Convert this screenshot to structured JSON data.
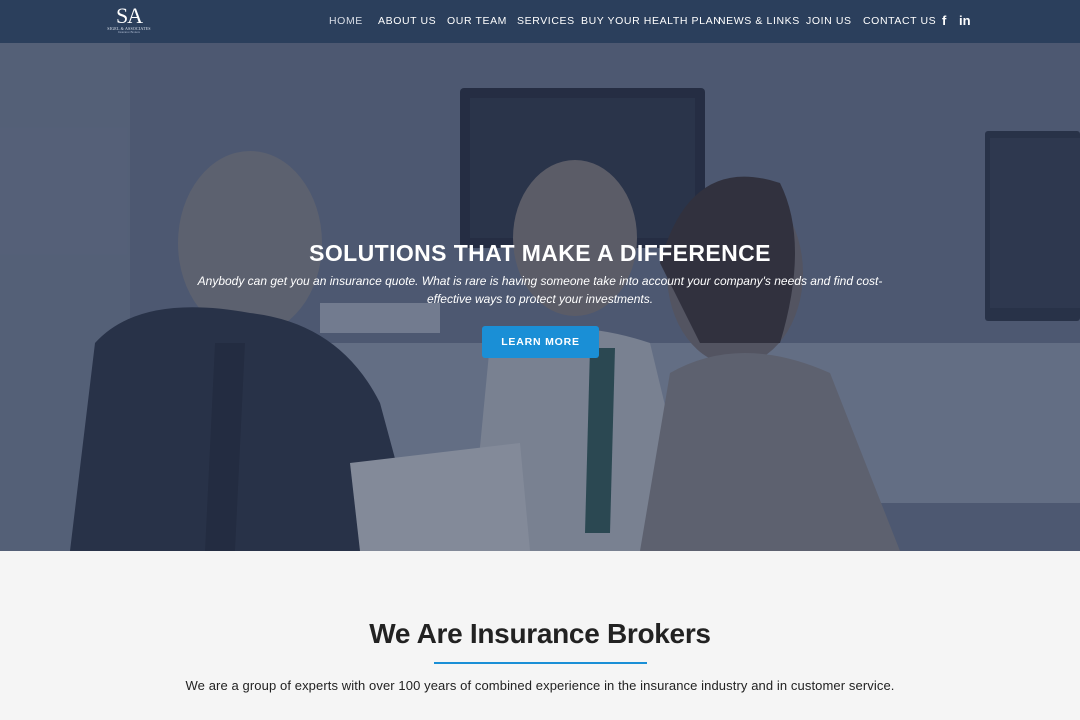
{
  "brand": {
    "logo_mark": "SA",
    "logo_line1": "SIGEL & ASSOCIATES",
    "logo_line2": "Insurance Brokers"
  },
  "nav": {
    "items": [
      {
        "label": "HOME",
        "active": true
      },
      {
        "label": "ABOUT US"
      },
      {
        "label": "OUR TEAM"
      },
      {
        "label": "SERVICES"
      },
      {
        "label": "BUY YOUR HEALTH PLAN"
      },
      {
        "label": "NEWS & LINKS"
      },
      {
        "label": "JOIN US"
      },
      {
        "label": "CONTACT US"
      }
    ],
    "social": [
      {
        "icon": "facebook-icon",
        "glyph": "f"
      },
      {
        "icon": "linkedin-icon",
        "glyph": "in"
      }
    ]
  },
  "hero": {
    "title": "SOLUTIONS THAT MAKE A DIFFERENCE",
    "text": "Anybody can get you an insurance quote. What is rare is having someone take into account your company's needs and find cost-effective ways to protect your investments.",
    "button_label": "LEARN MORE"
  },
  "intro": {
    "title": "We Are Insurance Brokers",
    "text": "We are a group of experts with over 100 years of combined experience in the insurance industry and in customer service."
  },
  "colors": {
    "header_bg": "#2b3f5c",
    "accent": "#1a8fd6",
    "section_bg": "#f5f5f5"
  }
}
